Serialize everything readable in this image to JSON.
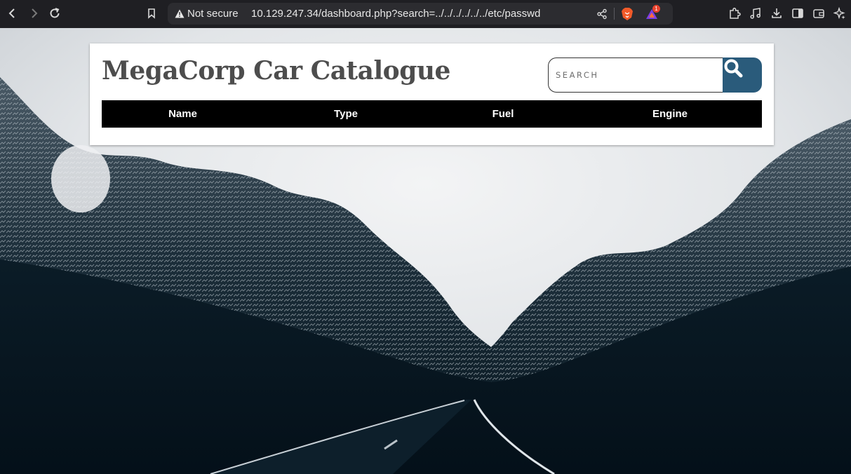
{
  "browser": {
    "security_label": "Not secure",
    "url": "10.129.247.34/dashboard.php?search=../../../../../../etc/passwd",
    "rewards_badge": "1",
    "colors": {
      "chrome_bg": "#1f1f23",
      "omnibox_bg": "#2c2c30",
      "brave_orange": "#f25a29"
    }
  },
  "page": {
    "title": "MegaCorp Car Catalogue",
    "search": {
      "placeholder": "SEARCH",
      "value": ""
    },
    "table": {
      "columns": [
        "Name",
        "Type",
        "Fuel",
        "Engine"
      ],
      "rows": []
    },
    "colors": {
      "accent": "#2a5b7b",
      "header_bg": "#000000",
      "title_color": "#4d4d4d"
    }
  }
}
